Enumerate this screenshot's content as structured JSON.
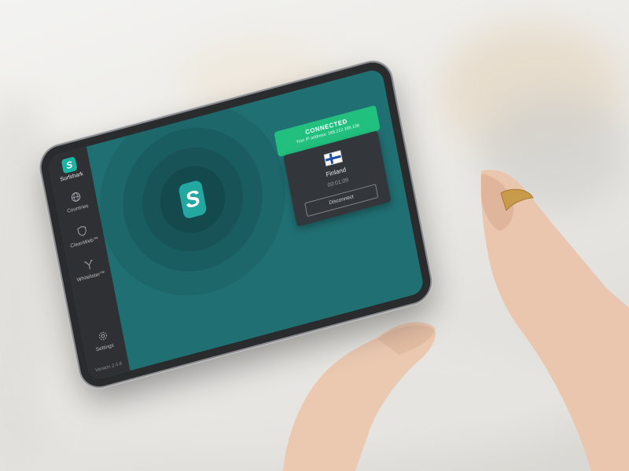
{
  "app": {
    "brand_name": "Surfshark",
    "logo_letter": "S",
    "version": "Version 2.4.8"
  },
  "sidebar": {
    "items": [
      {
        "label": "Countries",
        "icon": "globe-icon"
      },
      {
        "label": "CleanWeb™",
        "icon": "shield-icon"
      },
      {
        "label": "Whitelister™",
        "icon": "split-icon"
      },
      {
        "label": "Settings",
        "icon": "gear-icon"
      }
    ]
  },
  "connection": {
    "status": "CONNECTED",
    "ip_text": "Your IP address: 185.212.169.108",
    "country": "Finland",
    "timer": "00:01:09",
    "disconnect_label": "Disconnect"
  },
  "colors": {
    "accent": "#22c07f",
    "screen": "#206f73",
    "logo": "#22a8a0",
    "sidebar": "#2e3033"
  }
}
